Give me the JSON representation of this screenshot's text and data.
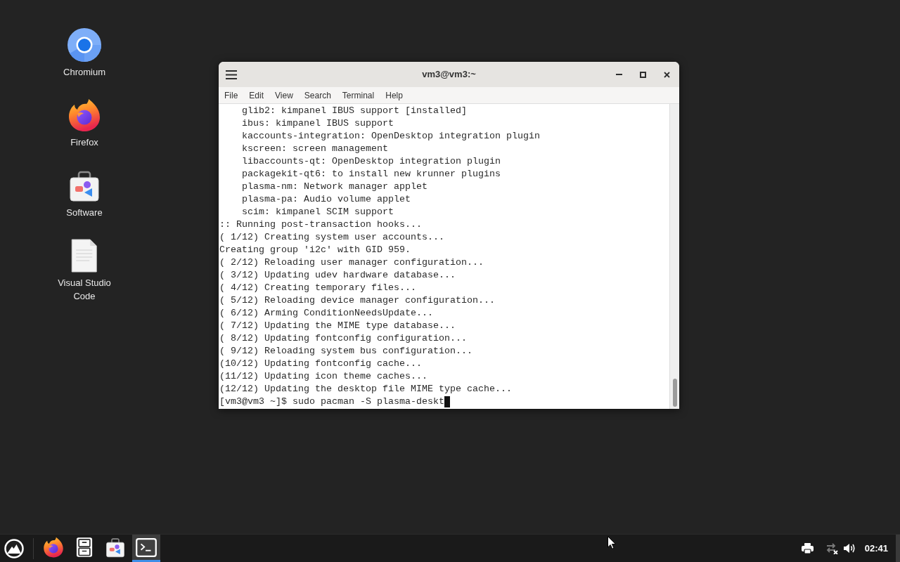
{
  "desktop_icons": [
    {
      "label": "Chromium",
      "kind": "chromium"
    },
    {
      "label": "Firefox",
      "kind": "firefox"
    },
    {
      "label": "Software",
      "kind": "store"
    },
    {
      "label": "Visual Studio Code",
      "kind": "document"
    }
  ],
  "window": {
    "title": "vm3@vm3:~",
    "menu": [
      "File",
      "Edit",
      "View",
      "Search",
      "Terminal",
      "Help"
    ],
    "lines": [
      {
        "text": "glib2: kimpanel IBUS support [installed]",
        "indented": true
      },
      {
        "text": "ibus: kimpanel IBUS support",
        "indented": true
      },
      {
        "text": "kaccounts-integration: OpenDesktop integration plugin",
        "indented": true
      },
      {
        "text": "kscreen: screen management",
        "indented": true
      },
      {
        "text": "libaccounts-qt: OpenDesktop integration plugin",
        "indented": true
      },
      {
        "text": "packagekit-qt6: to install new krunner plugins",
        "indented": true
      },
      {
        "text": "plasma-nm: Network manager applet",
        "indented": true
      },
      {
        "text": "plasma-pa: Audio volume applet",
        "indented": true
      },
      {
        "text": "scim: kimpanel SCIM support",
        "indented": true
      },
      {
        "text": ":: Running post-transaction hooks...",
        "indented": false
      },
      {
        "text": "( 1/12) Creating system user accounts...",
        "indented": false
      },
      {
        "text": "Creating group 'i2c' with GID 959.",
        "indented": false
      },
      {
        "text": "( 2/12) Reloading user manager configuration...",
        "indented": false
      },
      {
        "text": "( 3/12) Updating udev hardware database...",
        "indented": false
      },
      {
        "text": "( 4/12) Creating temporary files...",
        "indented": false
      },
      {
        "text": "( 5/12) Reloading device manager configuration...",
        "indented": false
      },
      {
        "text": "( 6/12) Arming ConditionNeedsUpdate...",
        "indented": false
      },
      {
        "text": "( 7/12) Updating the MIME type database...",
        "indented": false
      },
      {
        "text": "( 8/12) Updating fontconfig configuration...",
        "indented": false
      },
      {
        "text": "( 9/12) Reloading system bus configuration...",
        "indented": false
      },
      {
        "text": "(10/12) Updating fontconfig cache...",
        "indented": false
      },
      {
        "text": "(11/12) Updating icon theme caches...",
        "indented": false
      },
      {
        "text": "(12/12) Updating the desktop file MIME type cache...",
        "indented": false
      }
    ],
    "prompt": "[vm3@vm3 ~]$",
    "command": "sudo pacman -S plasma-deskt"
  },
  "taskbar": {
    "apps": [
      {
        "kind": "firefox",
        "selected": false
      },
      {
        "kind": "files",
        "selected": false
      },
      {
        "kind": "store",
        "selected": false
      },
      {
        "kind": "terminal",
        "selected": true
      }
    ],
    "network_connected": false,
    "clock": "02:41"
  }
}
